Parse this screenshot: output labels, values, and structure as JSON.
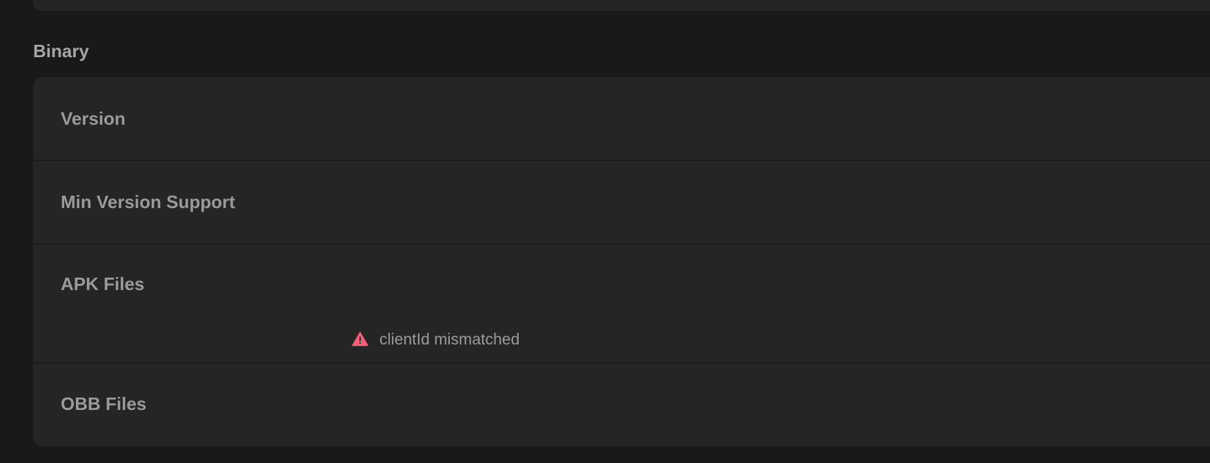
{
  "section": {
    "title": "Binary"
  },
  "rows": [
    {
      "label": "Version"
    },
    {
      "label": "Min Version Support"
    },
    {
      "label": "APK Files",
      "warning": {
        "text": "clientId mismatched",
        "icon": "warning-triangle-icon",
        "color": "#f0607a"
      }
    },
    {
      "label": "OBB Files"
    }
  ],
  "colors": {
    "page_background": "#191919",
    "card_background": "#252525",
    "label_text": "#9a9a9a",
    "warning_accent": "#f0607a"
  }
}
